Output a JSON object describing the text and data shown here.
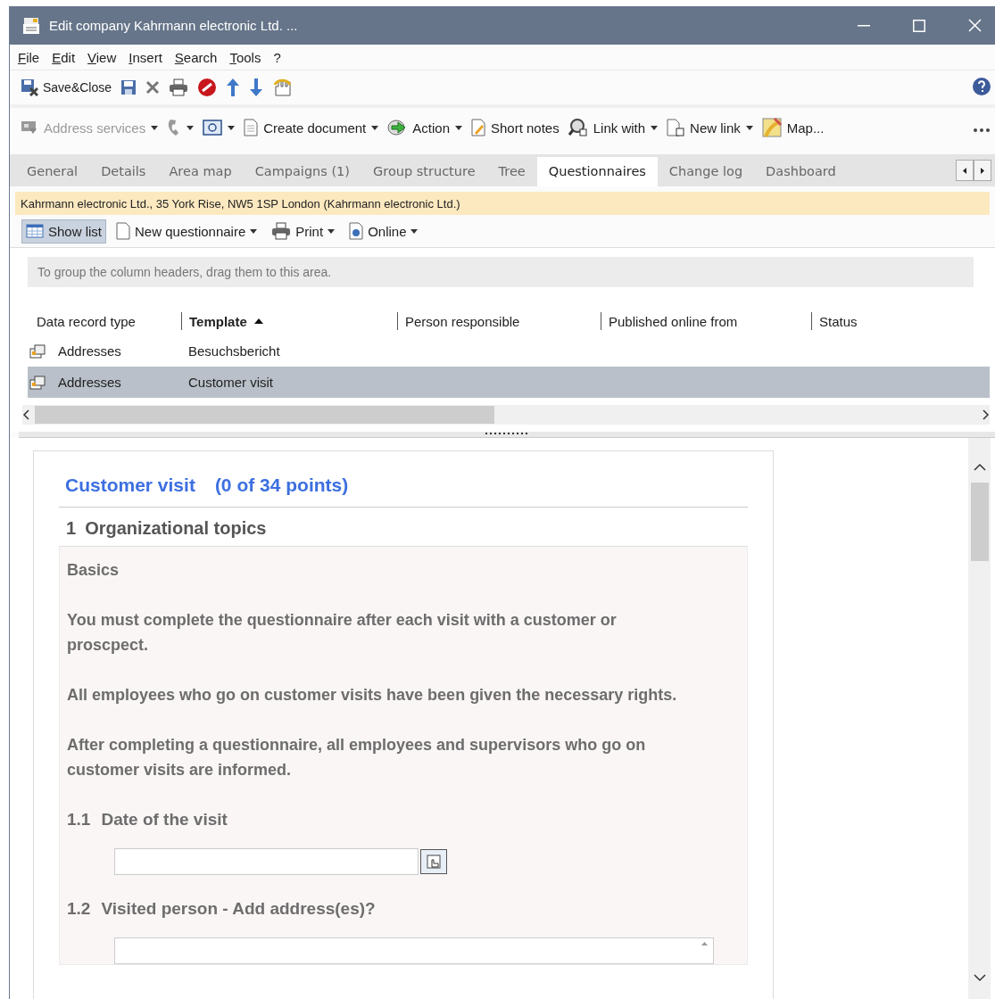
{
  "window": {
    "title": "Edit company Kahrmann electronic Ltd. ..."
  },
  "menu": [
    {
      "label": "File"
    },
    {
      "label": "Edit"
    },
    {
      "label": "View"
    },
    {
      "label": "Insert"
    },
    {
      "label": "Search"
    },
    {
      "label": "Tools"
    },
    {
      "label": "?"
    }
  ],
  "toolbar": [
    {
      "kind": "labeled",
      "label": "Save&Close"
    },
    {
      "kind": "icon"
    },
    {
      "kind": "icon"
    },
    {
      "kind": "icon"
    },
    {
      "kind": "icon"
    },
    {
      "kind": "icon"
    },
    {
      "kind": "icon"
    },
    {
      "kind": "icon"
    }
  ],
  "action_bar": [
    {
      "label": "Address services",
      "dropdown": true,
      "disabled": true
    },
    {
      "dropdown": true,
      "disabled": false
    },
    {
      "dropdown": true,
      "disabled": false
    },
    {
      "label": "Create document",
      "dropdown": true,
      "disabled": false
    },
    {
      "label": "Action",
      "dropdown": true,
      "disabled": false
    },
    {
      "label": "Short notes",
      "dropdown": false,
      "disabled": false
    },
    {
      "label": "Link with",
      "dropdown": true,
      "disabled": false
    },
    {
      "label": "New link",
      "dropdown": true,
      "disabled": false
    },
    {
      "label": "Map...",
      "dropdown": false,
      "disabled": false
    }
  ],
  "tabs": [
    {
      "label": "General",
      "selected": false
    },
    {
      "label": "Details",
      "selected": false
    },
    {
      "label": "Area map",
      "selected": false
    },
    {
      "label": "Campaigns (1)",
      "selected": false
    },
    {
      "label": "Group structure",
      "selected": false
    },
    {
      "label": "Tree",
      "selected": false
    },
    {
      "label": "Questionnaires",
      "selected": true
    },
    {
      "label": "Change log",
      "selected": false
    },
    {
      "label": "Dashboard",
      "selected": false
    }
  ],
  "info_bar": "Kahrmann electronic Ltd.,  35 York Rise,  NW5 1SP London (Kahrmann electronic Ltd.)",
  "list_toolbar": [
    {
      "label": "Show list",
      "dropdown": false,
      "selected": true
    },
    {
      "label": "New questionnaire",
      "dropdown": true,
      "selected": false
    },
    {
      "label": "Print",
      "dropdown": true,
      "selected": false
    },
    {
      "label": "Online",
      "dropdown": true,
      "selected": false
    }
  ],
  "grid": {
    "group_hint": "To group the column headers, drag them to this area.",
    "columns": [
      {
        "label": "Data record type",
        "sorted": false
      },
      {
        "label": "Template",
        "sorted": true
      },
      {
        "label": "Person responsible",
        "sorted": false
      },
      {
        "label": "Published online from",
        "sorted": false
      },
      {
        "label": "Status",
        "sorted": false
      }
    ],
    "rows": [
      {
        "data_record_type": "Addresses",
        "template": "Besuchsbericht",
        "selected": false
      },
      {
        "data_record_type": "Addresses",
        "template": "Customer visit",
        "selected": true
      }
    ]
  },
  "questionnaire": {
    "title": "Customer visit",
    "points": "(0 of 34 points)",
    "section": {
      "number": "1",
      "title": "Organizational topics"
    },
    "group_title": "Basics",
    "paragraphs": [
      "You must complete the questionnaire after each visit with a customer or proscpect.",
      "All employees who go on customer visits have been given the necessary rights.",
      "After completing a questionnaire, all employees and supervisors who go on customer visits are informed."
    ],
    "questions": [
      {
        "number": "1.1",
        "text": "Date of the visit",
        "kind": "date"
      },
      {
        "number": "1.2",
        "text": "Visited person - Add address(es)?",
        "kind": "address"
      }
    ]
  }
}
